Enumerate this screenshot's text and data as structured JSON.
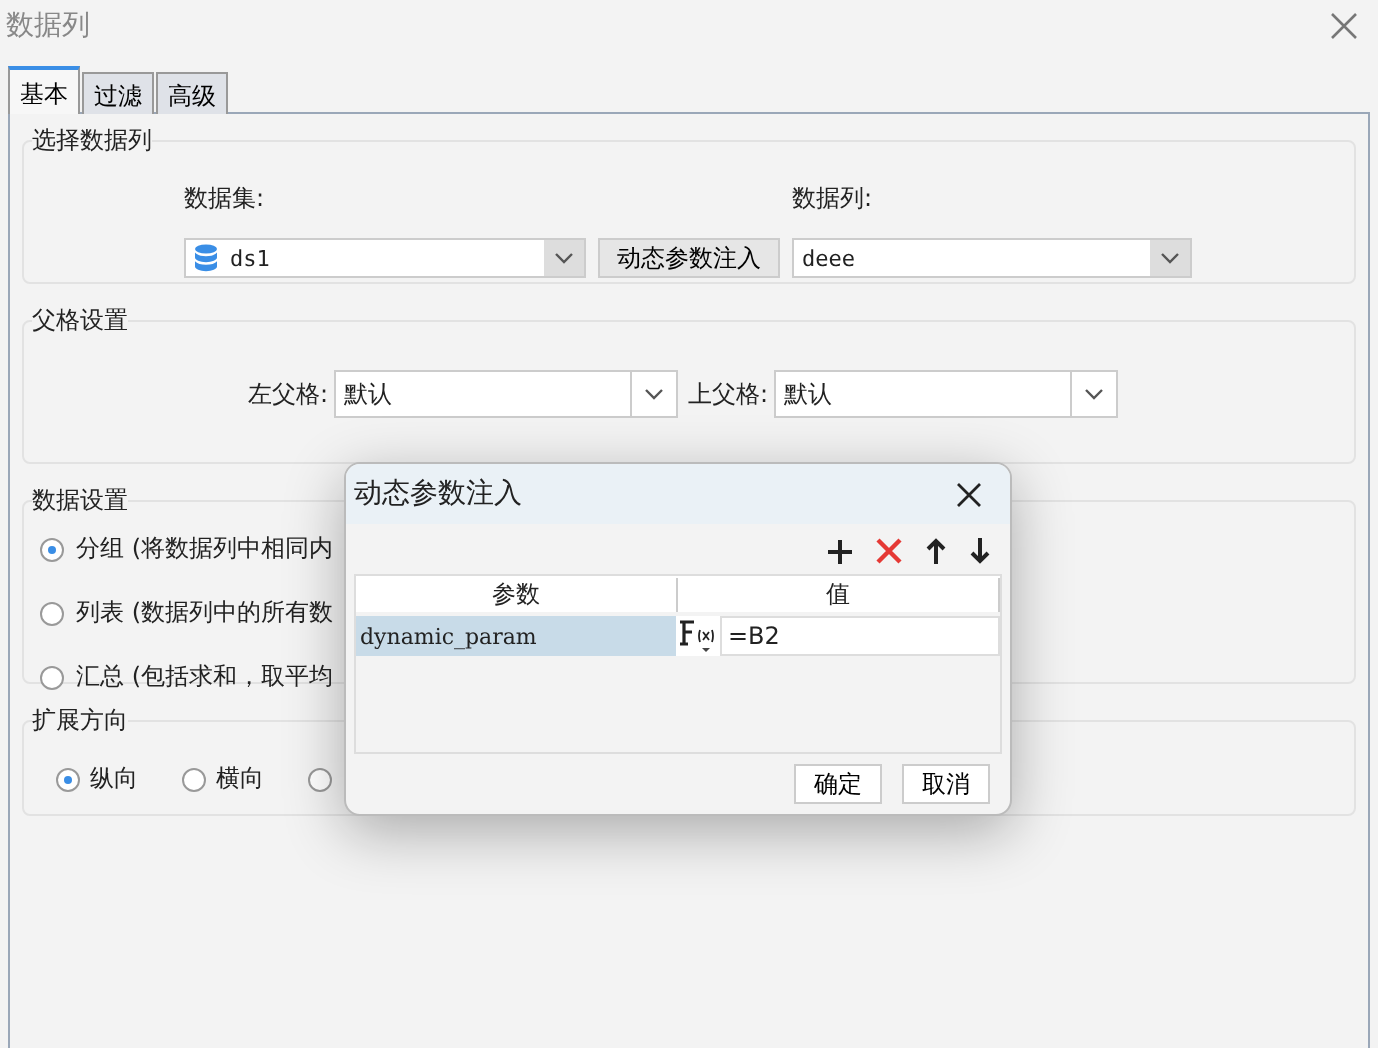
{
  "window": {
    "title": "数据列"
  },
  "tabs": [
    {
      "label": "基本",
      "selected": true
    },
    {
      "label": "过滤",
      "selected": false
    },
    {
      "label": "高级",
      "selected": false
    }
  ],
  "select_column": {
    "title": "选择数据列",
    "dataset_label": "数据集:",
    "dataset_value": "ds1",
    "inject_button": "动态参数注入",
    "column_label": "数据列:",
    "column_value": "deee"
  },
  "parent_settings": {
    "title": "父格设置",
    "left_label": "左父格:",
    "left_value": "默认",
    "top_label": "上父格:",
    "top_value": "默认"
  },
  "data_settings": {
    "title": "数据设置",
    "options": [
      {
        "label": "分组 (将数据列中相同内",
        "selected": true
      },
      {
        "label": "列表 (数据列中的所有数",
        "selected": false
      },
      {
        "label": "汇总 (包括求和，取平均",
        "selected": false
      }
    ]
  },
  "expand_direction": {
    "title": "扩展方向",
    "options": [
      {
        "label": "纵向",
        "selected": true
      },
      {
        "label": "横向",
        "selected": false
      },
      {
        "selected": false
      }
    ]
  },
  "dialog": {
    "title": "动态参数注入",
    "columns": [
      "参数",
      "值"
    ],
    "rows": [
      {
        "name": "dynamic_param",
        "value": "=B2",
        "selected": true
      }
    ],
    "buttons": [
      "确定",
      "取消"
    ]
  }
}
